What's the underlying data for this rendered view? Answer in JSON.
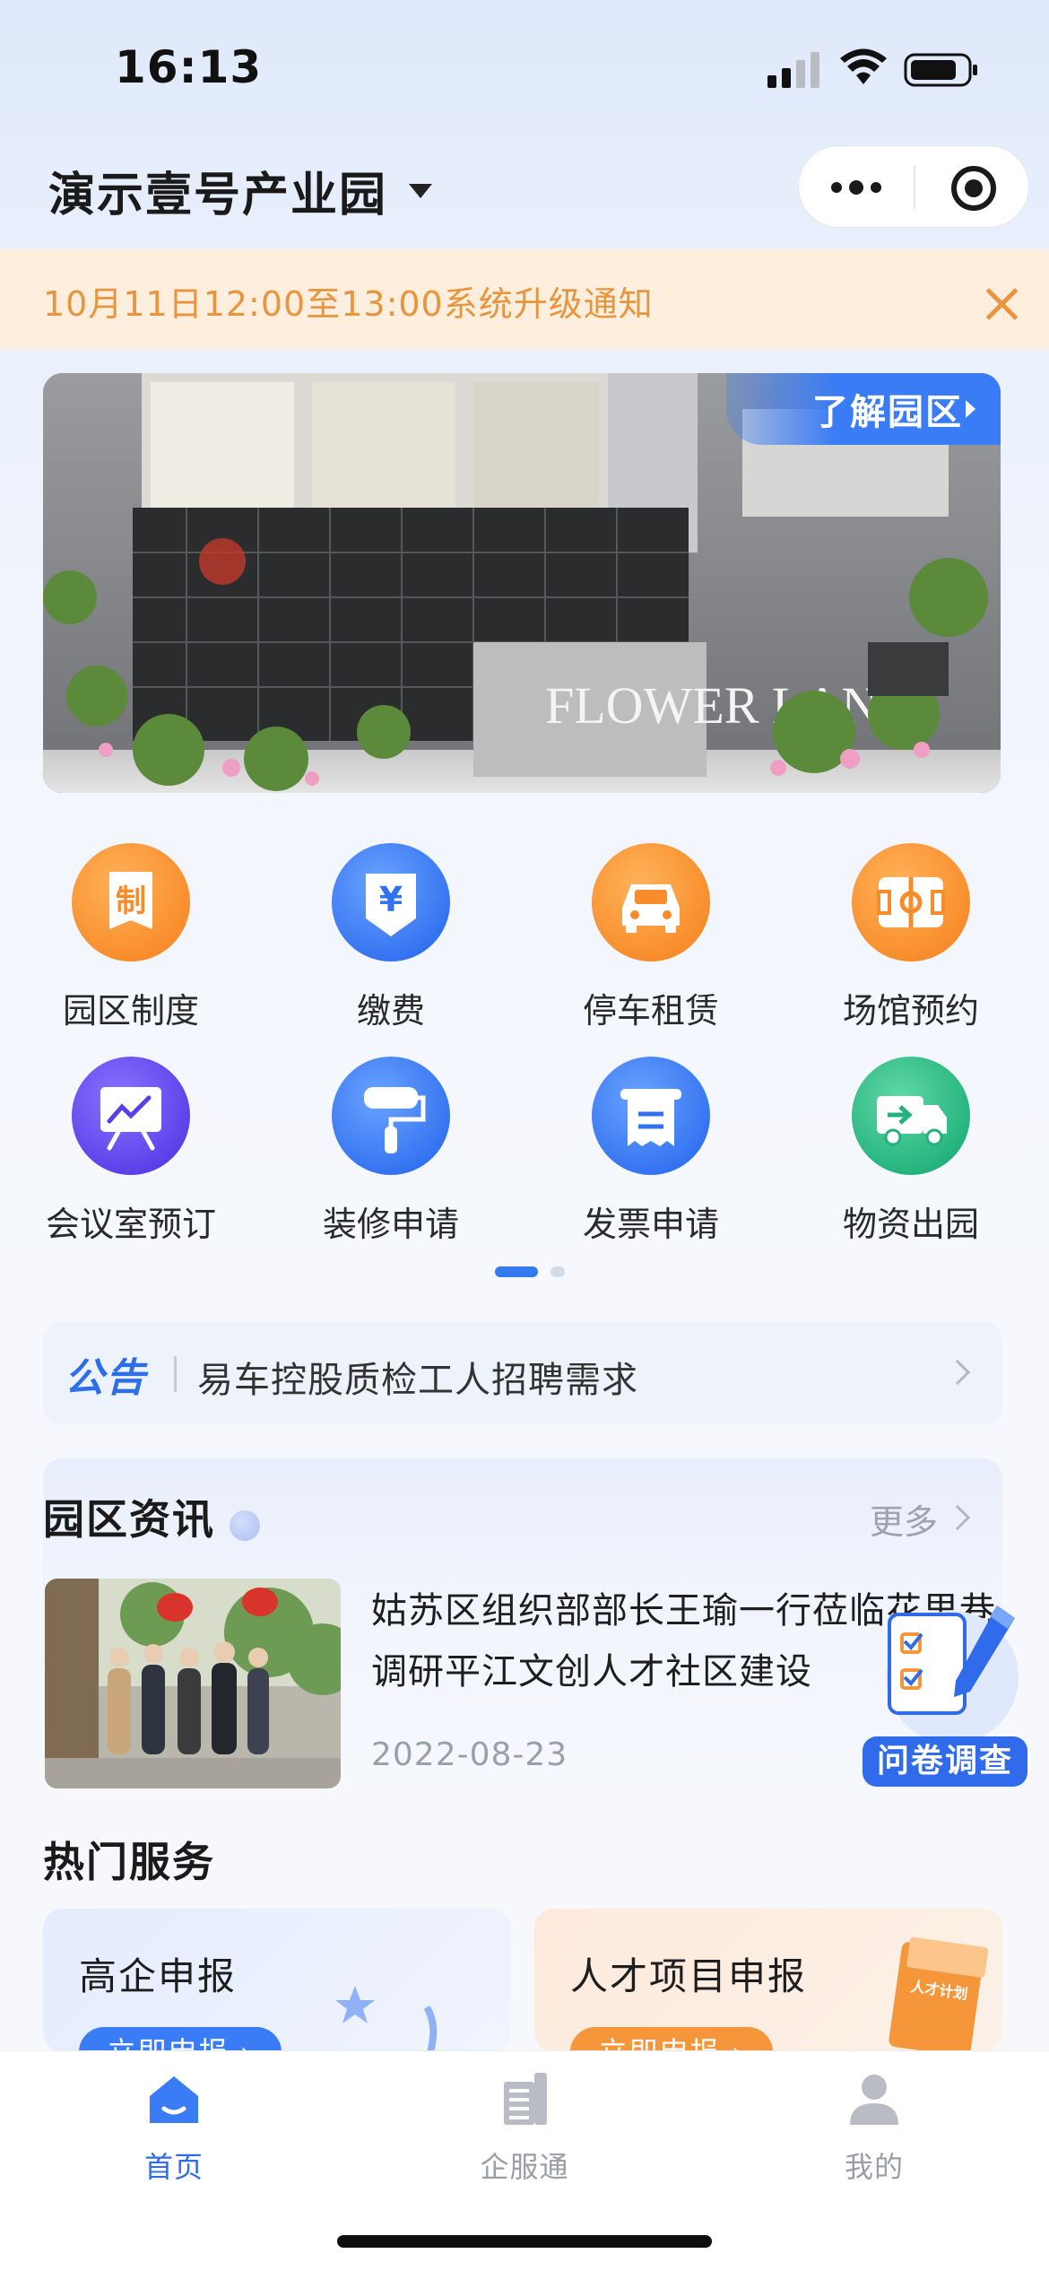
{
  "status_bar": {
    "time": "16:13"
  },
  "header": {
    "title": "演示壹号产业园"
  },
  "notice": {
    "text": "10月11日12:00至13:00系统升级通知"
  },
  "banner": {
    "tag_label": "了解园区",
    "sign_text": "FLOWER LANE"
  },
  "services": [
    {
      "label": "园区制度",
      "icon": "regulation-icon",
      "icon_glyph": "制",
      "color": "#f88b2a"
    },
    {
      "label": "缴费",
      "icon": "payment-icon",
      "icon_glyph": "¥",
      "color": "#3272f0"
    },
    {
      "label": "停车租赁",
      "icon": "car-icon",
      "color": "#f88b2a"
    },
    {
      "label": "场馆预约",
      "icon": "venue-icon",
      "color": "#f88b2a"
    },
    {
      "label": "会议室预订",
      "icon": "meeting-room-icon",
      "color": "#5a3ee8"
    },
    {
      "label": "装修申请",
      "icon": "paint-roller-icon",
      "color": "#3272f0"
    },
    {
      "label": "发票申请",
      "icon": "invoice-icon",
      "color": "#3272f0"
    },
    {
      "label": "物资出园",
      "icon": "delivery-truck-icon",
      "color": "#23b27b"
    }
  ],
  "pager": {
    "pages": 2,
    "active": 1
  },
  "announcement": {
    "tag": "公告",
    "text": "易车控股质检工人招聘需求"
  },
  "news": {
    "title": "园区资讯",
    "more_label": "更多",
    "items": [
      {
        "headline": "姑苏区组织部部长王瑜一行莅临花里巷调研平江文创人才社区建设",
        "date": "2022-08-23"
      }
    ]
  },
  "survey": {
    "label": "问卷调查"
  },
  "hot_services": {
    "title": "热门服务",
    "cards": [
      {
        "title": "高企申报",
        "button": "立即申报 ›"
      },
      {
        "title": "人才项目申报",
        "button": "立即申报 ›",
        "badge": "人才计划"
      }
    ]
  },
  "tabbar": {
    "tabs": [
      {
        "label": "首页",
        "icon": "home-icon",
        "active": true
      },
      {
        "label": "企服通",
        "icon": "building-icon",
        "active": false
      },
      {
        "label": "我的",
        "icon": "profile-icon",
        "active": false
      }
    ]
  },
  "colors": {
    "primary": "#2f6bea",
    "notice_bg": "#fdeedd",
    "notice_text": "#e7953e",
    "orange": "#f88b2a"
  }
}
